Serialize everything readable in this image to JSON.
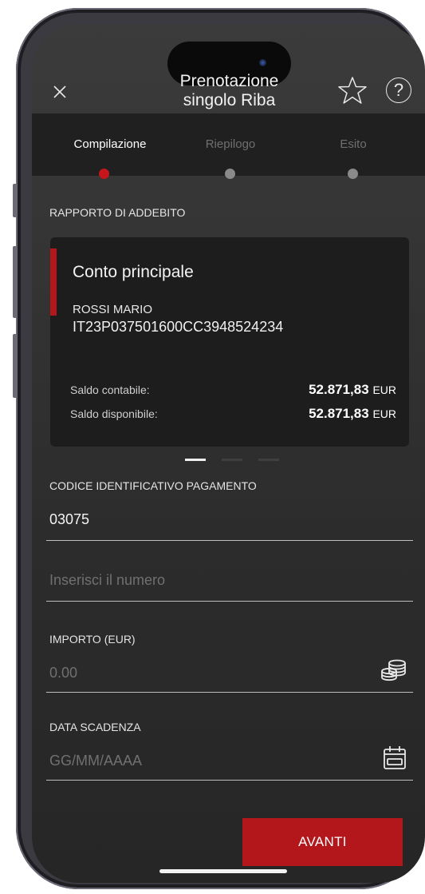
{
  "header": {
    "title_line1": "Prenotazione",
    "title_line2": "singolo Riba",
    "close_icon": "close-icon",
    "star_icon": "star-icon",
    "help_icon": "help-icon",
    "help_glyph": "?"
  },
  "stepper": {
    "steps": [
      {
        "label": "Compilazione",
        "active": true
      },
      {
        "label": "Riepilogo",
        "active": false
      },
      {
        "label": "Esito",
        "active": false
      }
    ]
  },
  "debit_section": {
    "label": "RAPPORTO DI ADDEBITO",
    "card": {
      "account_name": "Conto principale",
      "holder": "ROSSI MARIO",
      "iban": "IT23P037501600CC3948524234",
      "accounting_balance_label": "Saldo contabile:",
      "accounting_balance_value": "52.871,83",
      "available_balance_label": "Saldo disponibile:",
      "available_balance_value": "52.871,83",
      "currency": "EUR"
    },
    "pager": {
      "pages": 3,
      "active": 1
    }
  },
  "payment_code": {
    "label": "CODICE IDENTIFICATIVO PAGAMENTO",
    "value": "03075",
    "number_placeholder": "Inserisci il numero"
  },
  "amount": {
    "label": "IMPORTO (EUR)",
    "placeholder": "0.00",
    "icon": "coins-icon"
  },
  "due_date": {
    "label": "DATA SCADENZA",
    "placeholder": "GG/MM/AAAA",
    "icon": "calendar-icon"
  },
  "actions": {
    "next_label": "AVANTI"
  },
  "colors": {
    "accent": "#b3161b",
    "background": "#2c2c2c",
    "card": "#1d1d1d"
  }
}
